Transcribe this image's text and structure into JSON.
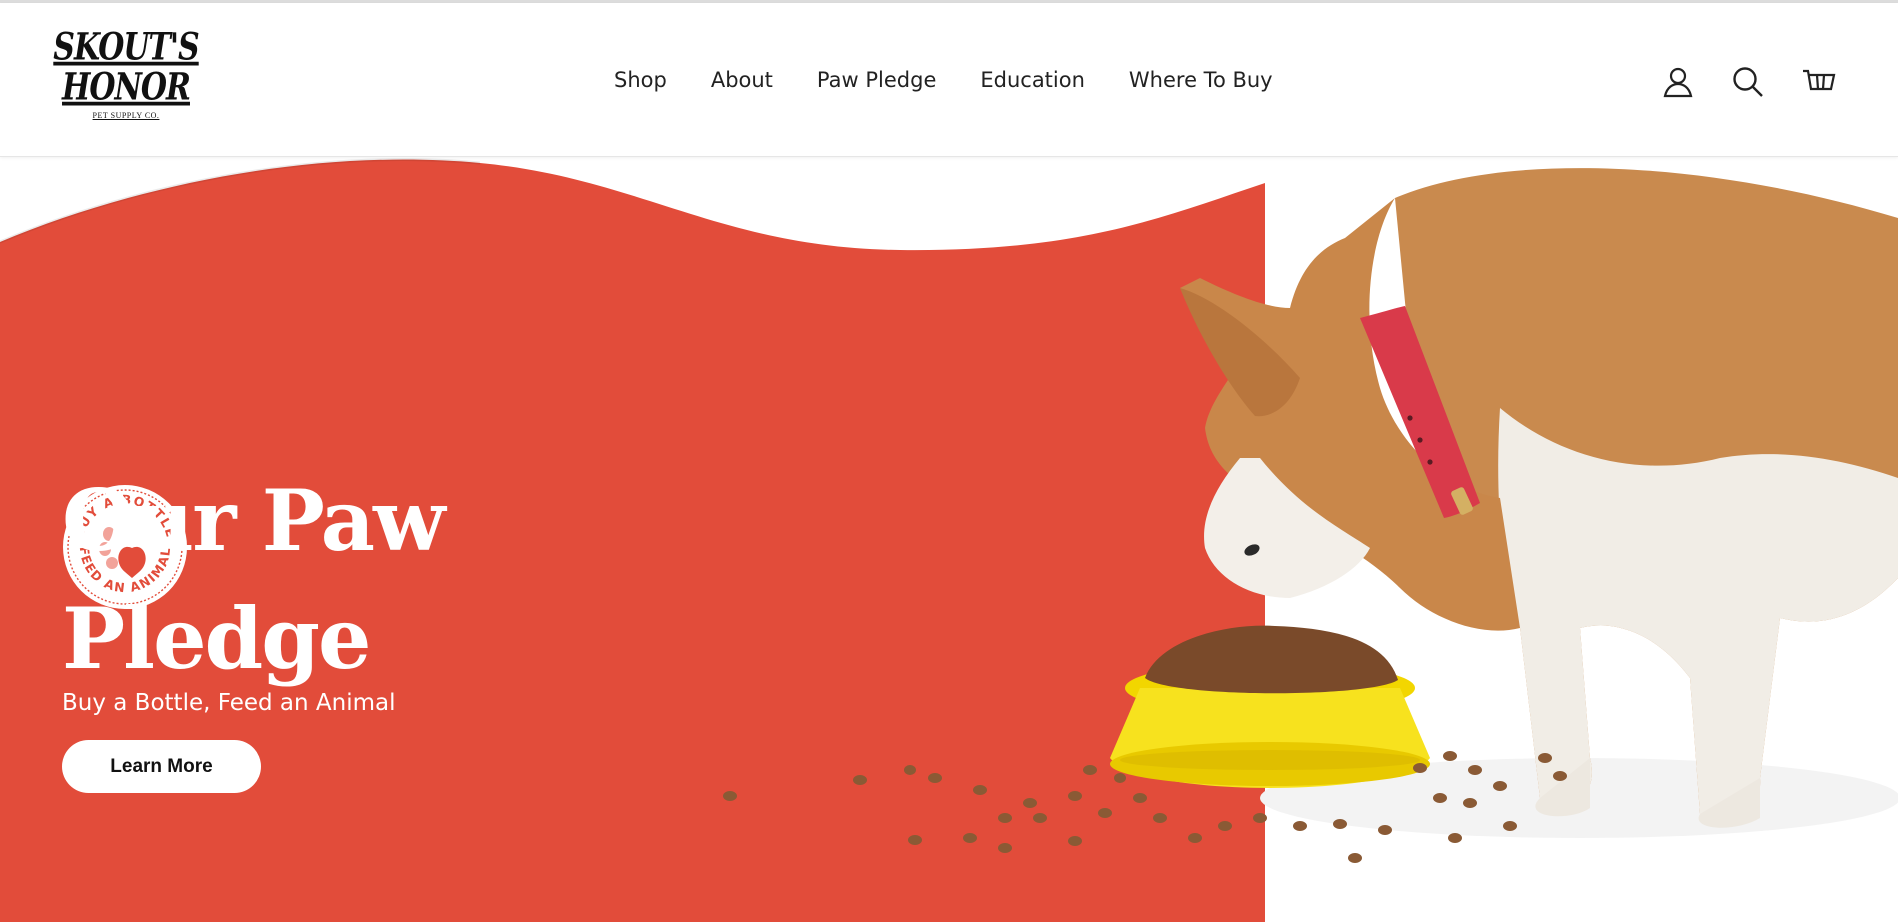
{
  "brand": {
    "logo_line1": "SKOUT'S",
    "logo_line2": "HONOR",
    "logo_tagline": "PET SUPPLY CO."
  },
  "nav": {
    "items": [
      {
        "label": "Shop"
      },
      {
        "label": "About"
      },
      {
        "label": "Paw Pledge"
      },
      {
        "label": "Education"
      },
      {
        "label": "Where To Buy"
      }
    ]
  },
  "header_icons": [
    "account-icon",
    "search-icon",
    "cart-icon"
  ],
  "hero": {
    "badge_text_top": "BUY A BOTTLE",
    "badge_text_bottom": "FEED AN ANIMAL",
    "title_line1": "Our Paw",
    "title_line2": "Pledge",
    "subtitle": "Buy a Bottle, Feed an Animal",
    "cta_label": "Learn More"
  },
  "colors": {
    "hero_red": "#E24C3A",
    "badge_pink": "#F2A39A",
    "bowl_yellow": "#F7E21E",
    "dog_coat": "#C98A4E",
    "collar_red": "#D93A4A"
  }
}
